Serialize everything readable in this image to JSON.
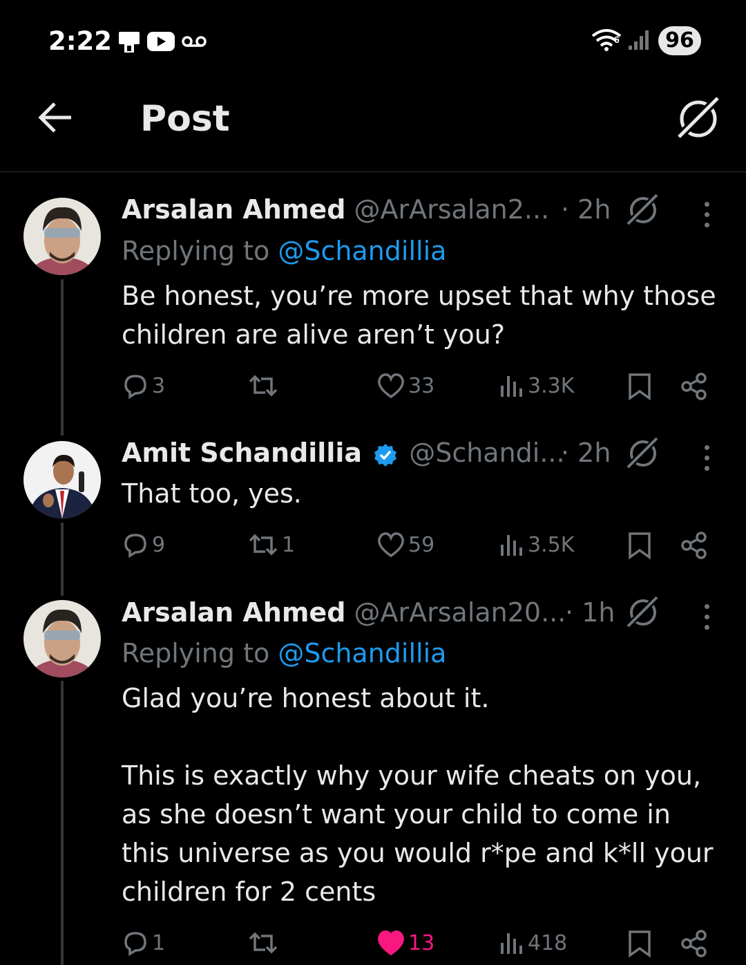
{
  "status_bar": {
    "time": "2:22",
    "battery": "96"
  },
  "header": {
    "title": "Post"
  },
  "posts": [
    {
      "name": "Arsalan Ahmed",
      "handle": "@ArArsalan2...",
      "time": "· 2h",
      "reply_prefix": "Replying to",
      "reply_handle": "@Schandillia",
      "text_lines": [
        "Be honest, you’re more upset that why those",
        "children are alive aren’t you?"
      ],
      "replies": "3",
      "reposts": "",
      "likes": "33",
      "views": "3.3K"
    },
    {
      "name": "Amit Schandillia",
      "handle": "@Schandi...",
      "time": "· 2h",
      "verified": true,
      "text_lines": [
        "That too, yes."
      ],
      "replies": "9",
      "reposts": "1",
      "likes": "59",
      "views": "3.5K"
    },
    {
      "name": "Arsalan Ahmed",
      "handle": "@ArArsalan20...",
      "time": "· 1h",
      "reply_prefix": "Replying to",
      "reply_handle": "@Schandillia",
      "text_lines": [
        "Glad you’re honest about it.",
        "",
        "This is exactly why your wife cheats on you,",
        "as she doesn’t want your child to come in",
        "this universe as you would r*pe and k*ll your",
        "children for 2 cents"
      ],
      "replies": "1",
      "reposts": "",
      "likes": "13",
      "views": "418",
      "liked": true
    }
  ],
  "colors": {
    "background": "#000000",
    "text": "#e7e9ea",
    "muted": "#71767b",
    "link": "#1d9bf0",
    "like": "#f91880",
    "verified": "#1d9bf0"
  },
  "icons": [
    "back-arrow-icon",
    "grok-icon",
    "reply-icon",
    "repost-icon",
    "heart-icon",
    "views-icon",
    "bookmark-icon",
    "share-icon",
    "more-icon",
    "verified-badge-icon",
    "wifi-icon",
    "signal-icon",
    "youtube-icon",
    "voicemail-icon"
  ]
}
